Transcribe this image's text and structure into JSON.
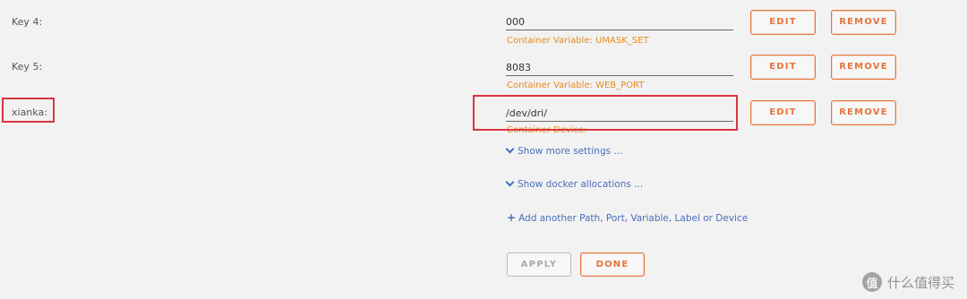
{
  "rows": [
    {
      "key": "Key 4:",
      "value": "000",
      "hint": "Container Variable: UMASK_SET",
      "edit": "EDIT",
      "remove": "REMOVE"
    },
    {
      "key": "Key 5:",
      "value": "8083",
      "hint": "Container Variable: WEB_PORT",
      "edit": "EDIT",
      "remove": "REMOVE"
    },
    {
      "key": "xianka:",
      "value": "/dev/dri/",
      "hint": "Container Device:",
      "edit": "EDIT",
      "remove": "REMOVE"
    }
  ],
  "links": {
    "more_settings": "Show more settings ...",
    "docker_allocations": "Show docker allocations ...",
    "add_another": "Add another Path, Port, Variable, Label or Device"
  },
  "actions": {
    "apply": "APPLY",
    "done": "DONE"
  },
  "watermark": {
    "logo_text": "值",
    "text": "什么值得买"
  },
  "colors": {
    "accent": "#e8743b",
    "hint": "#e58b1e",
    "link": "#486dba",
    "highlight": "#d9363e"
  }
}
